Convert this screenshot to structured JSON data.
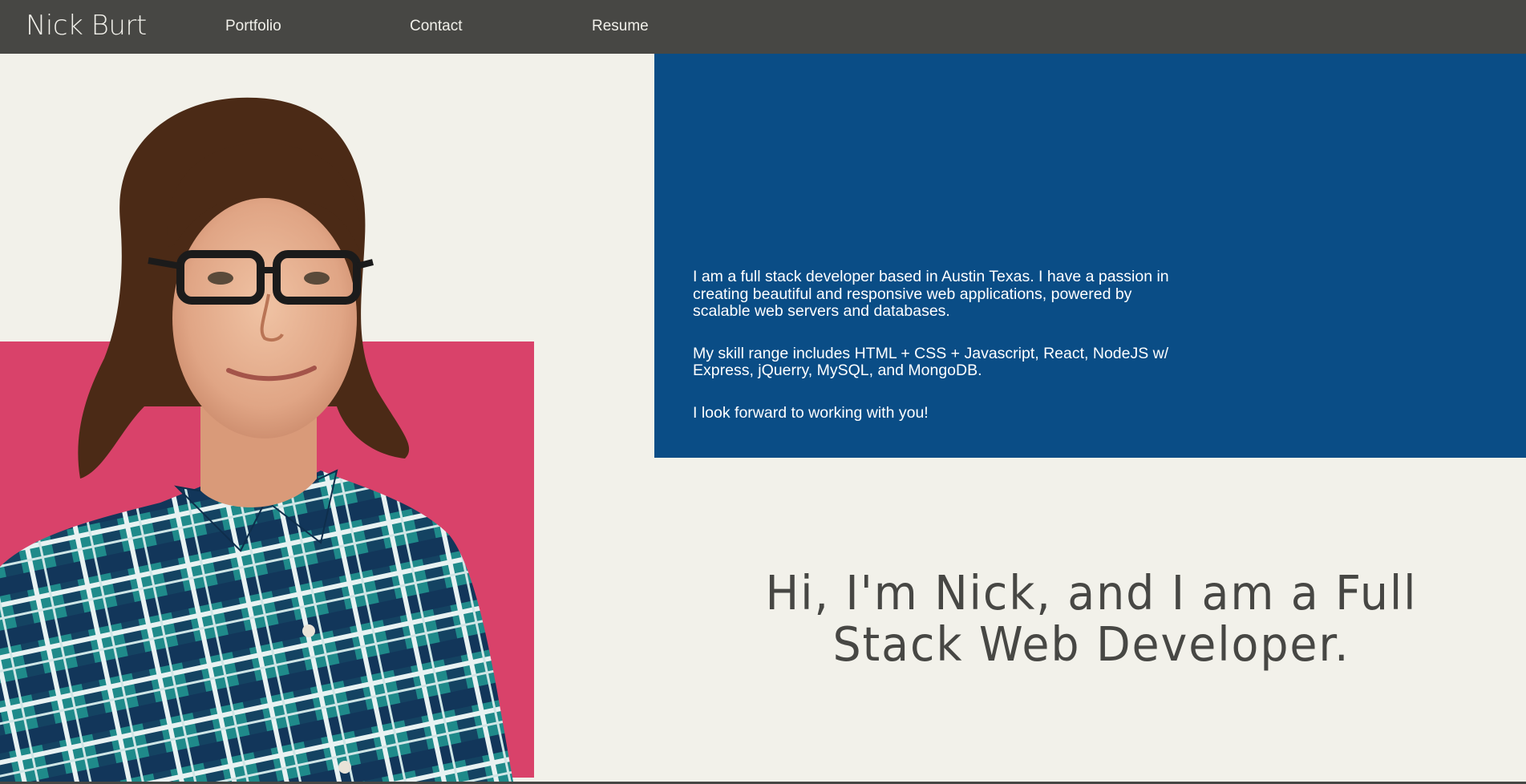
{
  "nav": {
    "brand": "Nick Burt",
    "links": [
      {
        "label": "Portfolio"
      },
      {
        "label": "Contact"
      },
      {
        "label": "Resume"
      }
    ]
  },
  "about": {
    "paragraphs": [
      "I am a full stack developer based in Austin Texas. I have a passion in creating beautiful and responsive web applications, powered by scalable web servers and databases.",
      "My skill range includes HTML + CSS + Javascript, React, NodeJS w/ Express, jQuerry, MySQL, and MongoDB.",
      "I look forward to working with you!"
    ]
  },
  "hero": {
    "headline": "Hi, I'm Nick, and I am a Full Stack Web Developer.",
    "photo_alt": "portrait-photo"
  },
  "colors": {
    "navbar": "#474744",
    "background": "#f2f1ea",
    "accent_pink": "#d9426a",
    "panel_blue": "#0a4d86",
    "headline_text": "#474744"
  }
}
